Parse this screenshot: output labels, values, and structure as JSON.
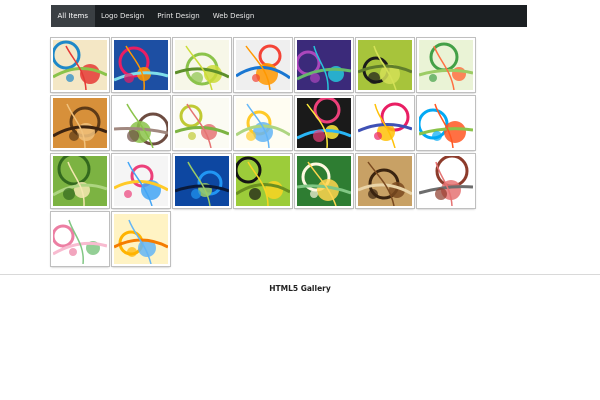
{
  "nav": {
    "tabs": [
      {
        "label": "All Items",
        "active": true
      },
      {
        "label": "Logo Design",
        "active": false
      },
      {
        "label": "Print Design",
        "active": false
      },
      {
        "label": "Web Design",
        "active": false
      }
    ]
  },
  "gallery": {
    "items": [
      {
        "name": "thumb-circles-swirl",
        "colors": [
          "#f4e7c5",
          "#1e88c8",
          "#e53935",
          "#8bc34a"
        ]
      },
      {
        "name": "thumb-blue-orbs",
        "colors": [
          "#1d4fa3",
          "#e91e63",
          "#ff9800",
          "#80deea"
        ]
      },
      {
        "name": "thumb-green-floral",
        "colors": [
          "#f7f7e8",
          "#8bc34a",
          "#cddc39",
          "#5d8f2a"
        ]
      },
      {
        "name": "thumb-rainbow-arc",
        "colors": [
          "#efefef",
          "#f44336",
          "#ff9800",
          "#1976d2"
        ]
      },
      {
        "name": "thumb-purple-waves",
        "colors": [
          "#3b2a7a",
          "#ab47bc",
          "#26c6da",
          "#66bb6a"
        ]
      },
      {
        "name": "thumb-green-silhouette",
        "colors": [
          "#a7c43b",
          "#1b1b1b",
          "#d4e157",
          "#607d2b"
        ]
      },
      {
        "name": "thumb-green-swirl",
        "colors": [
          "#eaf3d6",
          "#43a047",
          "#ff7043",
          "#9ccc65"
        ]
      },
      {
        "name": "thumb-brown-tree",
        "colors": [
          "#d7903a",
          "#5d3a17",
          "#f1c27d",
          "#3e2410"
        ]
      },
      {
        "name": "thumb-brown-swirl",
        "colors": [
          "#ffffff",
          "#6d4c41",
          "#8bc34a",
          "#a1887f"
        ]
      },
      {
        "name": "thumb-yellow-flower",
        "colors": [
          "#fbfbf3",
          "#c0ca33",
          "#e57373",
          "#7cb342"
        ]
      },
      {
        "name": "thumb-butterfly",
        "colors": [
          "#fffdf2",
          "#ffca28",
          "#64b5f6",
          "#aed581"
        ]
      },
      {
        "name": "thumb-colorful-flower",
        "colors": [
          "#1a1a1a",
          "#ec407a",
          "#ffeb3b",
          "#29b6f6"
        ]
      },
      {
        "name": "thumb-paisley",
        "colors": [
          "#ffffff",
          "#e91e63",
          "#ffc107",
          "#3f51b5"
        ]
      },
      {
        "name": "thumb-color-drops",
        "colors": [
          "#ffffff",
          "#03a9f4",
          "#ff5722",
          "#8bc34a"
        ]
      },
      {
        "name": "thumb-green-vines",
        "colors": [
          "#7cb342",
          "#33691e",
          "#f4e7b0",
          "#aed581"
        ]
      },
      {
        "name": "thumb-circle-pattern",
        "colors": [
          "#f5f5f5",
          "#ec407a",
          "#42a5f5",
          "#ffca28"
        ]
      },
      {
        "name": "thumb-blue-rings",
        "colors": [
          "#0d47a1",
          "#2196f3",
          "#9ccc65",
          "#0a1a3a"
        ]
      },
      {
        "name": "thumb-city-skyline",
        "colors": [
          "#9ccc3a",
          "#151515",
          "#f9d423",
          "#6a8f20"
        ]
      },
      {
        "name": "thumb-white-lily",
        "colors": [
          "#2e7d32",
          "#fff8e1",
          "#ffd54f",
          "#81c784"
        ]
      },
      {
        "name": "thumb-grunge-brown",
        "colors": [
          "#c8a165",
          "#3a2410",
          "#7a4a20",
          "#e9d4a8"
        ]
      },
      {
        "name": "thumb-ornament",
        "colors": [
          "#ffffff",
          "#8d3b2b",
          "#e57373",
          "#6d6d6d"
        ]
      },
      {
        "name": "thumb-pink-flower",
        "colors": [
          "#ffffff",
          "#ec7fa3",
          "#81c784",
          "#f8bbd0"
        ]
      },
      {
        "name": "thumb-yellow-lily",
        "colors": [
          "#fff3c4",
          "#ffb300",
          "#64b5f6",
          "#f57c00"
        ]
      }
    ]
  },
  "footer": {
    "text": "HTML5 Gallery"
  }
}
